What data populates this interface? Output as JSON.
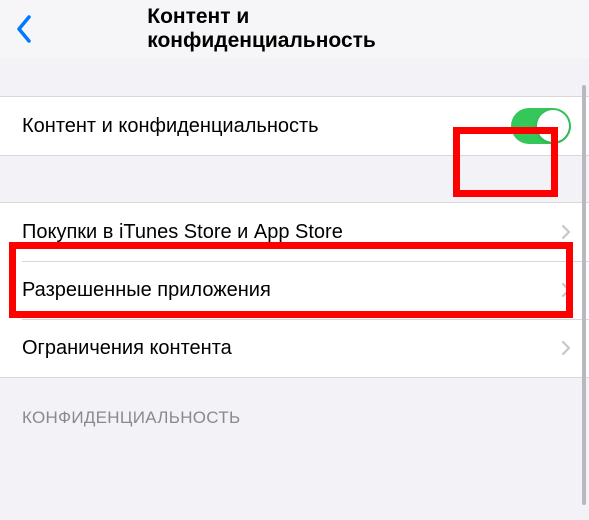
{
  "header": {
    "title": "Контент и конфиденциальность"
  },
  "group1": {
    "toggle_row": {
      "label": "Контент и конфиденциальность",
      "enabled": true
    }
  },
  "group2": {
    "items": [
      {
        "label": "Покупки в iTunes Store и App Store"
      },
      {
        "label": "Разрешенные приложения"
      },
      {
        "label": "Ограничения контента"
      }
    ]
  },
  "section_header": "КОНФИДЕНЦИАЛЬНОСТЬ"
}
